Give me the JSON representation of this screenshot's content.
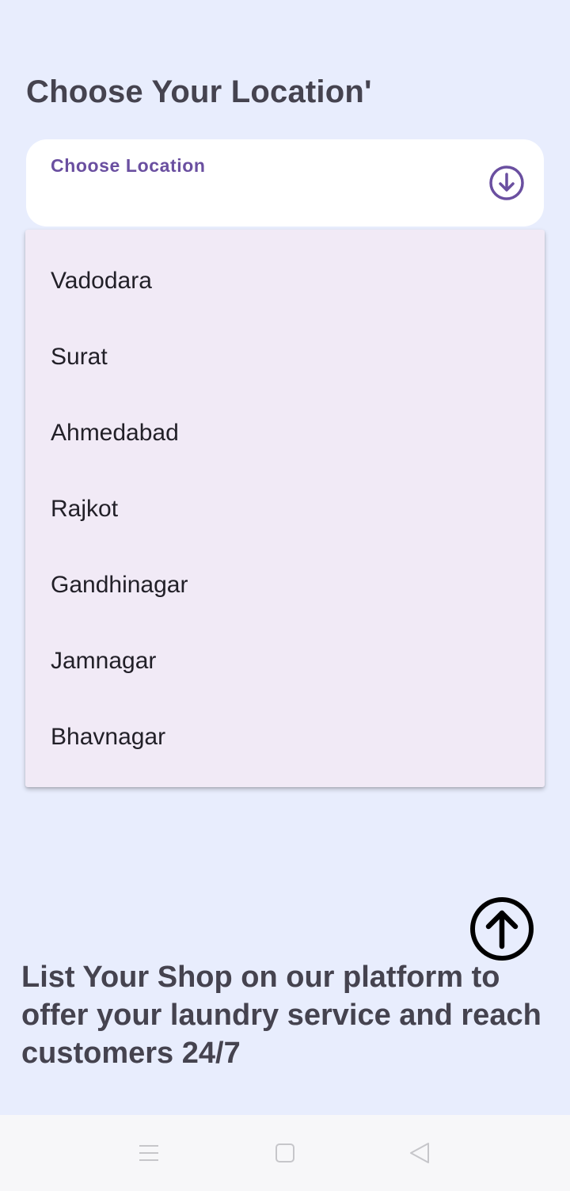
{
  "header": {
    "title": "Choose Your Location'"
  },
  "location_select": {
    "label": "Choose Location",
    "icon": "arrow-down-circle-icon",
    "accent_color": "#6a4fa0"
  },
  "dropdown": {
    "options": [
      "Vadodara",
      "Surat",
      "Ahmedabad",
      "Rajkot",
      "Gandhinagar",
      "Jamnagar",
      "Bhavnagar"
    ]
  },
  "scroll_top": {
    "icon": "arrow-up-circle-icon"
  },
  "promo": {
    "text": "List Your Shop on our platform to offer your laundry service and reach customers 24/7"
  },
  "system_nav": {
    "icons": [
      "menu-icon",
      "home-icon",
      "back-icon"
    ]
  }
}
